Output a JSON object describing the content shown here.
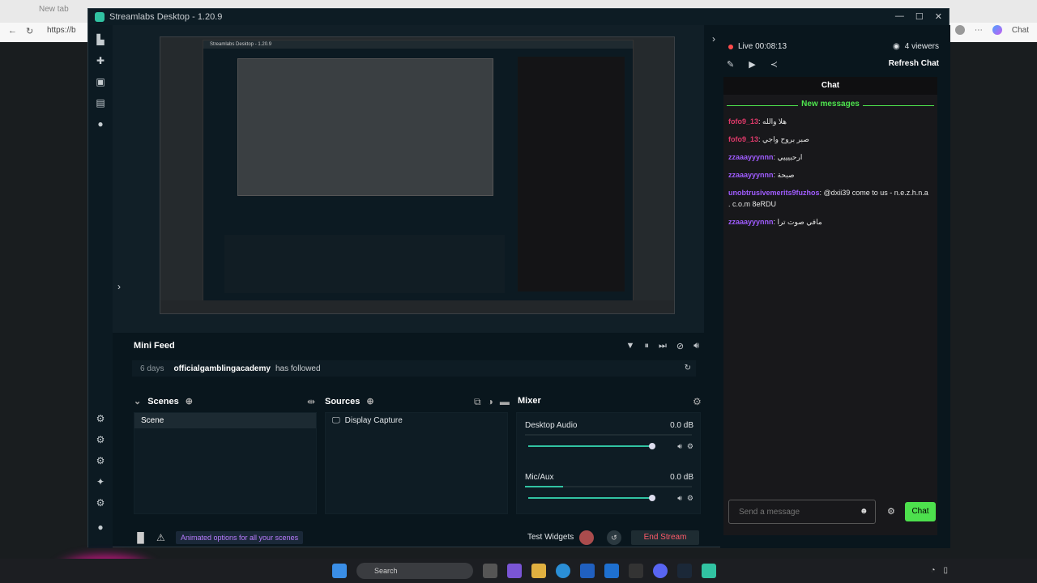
{
  "browser": {
    "tab_label": "New tab",
    "url_prefix": "https://b",
    "chat_label": "Chat"
  },
  "app": {
    "title": "Streamlabs Desktop - 1.20.9"
  },
  "mini_feed": {
    "title": "Mini Feed",
    "event": {
      "time": "6 days",
      "user": "officialgamblingacademy",
      "action": "has followed"
    }
  },
  "scenes": {
    "title": "Scenes",
    "items": [
      "Scene"
    ]
  },
  "sources": {
    "title": "Sources",
    "items": [
      "Display Capture"
    ]
  },
  "mixer": {
    "title": "Mixer",
    "channels": [
      {
        "label": "Desktop Audio",
        "db": "0.0 dB",
        "level": 0.98,
        "meter": 0.0
      },
      {
        "label": "Mic/Aux",
        "db": "0.0 dB",
        "level": 0.98,
        "meter": 0.23
      }
    ]
  },
  "bottom_bar": {
    "promo": "Animated options for all your scenes",
    "test_widgets": "Test Widgets",
    "end_stream": "End Stream"
  },
  "chat_panel": {
    "live_status": "Live 00:08:13",
    "viewers": "4 viewers",
    "refresh_label": "Refresh Chat",
    "title": "Chat",
    "new_messages_label": "New messages",
    "messages": [
      {
        "user": "fofo9_13",
        "user_color": "#e0396a",
        "text": "هلا والله"
      },
      {
        "user": "fofo9_13",
        "user_color": "#e0396a",
        "text": "صبر بروح واجي"
      },
      {
        "user": "zzaaayyynnn",
        "user_color": "#a05cff",
        "text": "ارحبيييي"
      },
      {
        "user": "zzaaayyynnn",
        "user_color": "#a05cff",
        "text": "صبحة"
      },
      {
        "user": "unobtrusivemerits9fuzhos",
        "user_color": "#a05cff",
        "text": "@dxii39 come to us - n.e.z.h.n.a . c.o.m 8eRDU"
      },
      {
        "user": "zzaaayyynnn",
        "user_color": "#a05cff",
        "text": "مافي صوت ترا"
      }
    ],
    "input_placeholder": "Send a message",
    "send_label": "Chat"
  },
  "taskbar": {
    "search_label": "Search"
  },
  "colors": {
    "accent": "#31c3a2",
    "live": "#ff4b4b",
    "chat_button": "#4de04d",
    "end_stream": "#ff5b6a"
  }
}
